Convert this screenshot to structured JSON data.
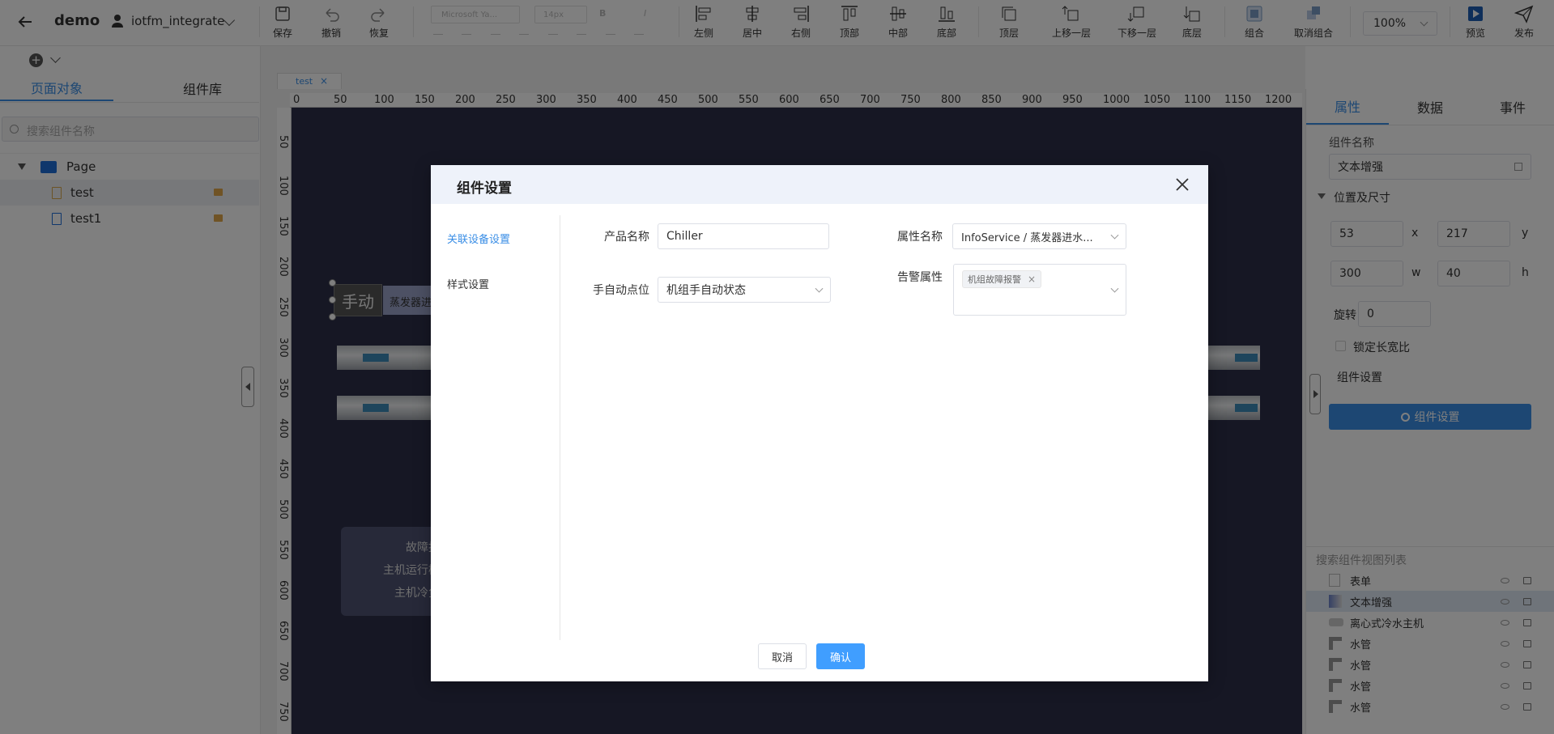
{
  "header": {
    "project": "demo",
    "user": "iotfm_integrate",
    "font_family": "Microsoft Ya...",
    "font_size": "14px",
    "zoom": "100%",
    "tools": {
      "save": "保存",
      "undo": "撤销",
      "redo": "恢复",
      "left": "左侧",
      "center": "居中",
      "right": "右侧",
      "top": "顶部",
      "middle": "中部",
      "bottom": "底部",
      "front": "顶层",
      "forward": "上移一层",
      "backward": "下移一层",
      "back": "底层",
      "group": "组合",
      "ungroup": "取消组合",
      "preview": "预览",
      "publish": "发布"
    }
  },
  "left_panel": {
    "tabs": [
      "页面对象",
      "组件库"
    ],
    "search_placeholder": "搜索组件名称",
    "tree": {
      "root": "Page",
      "children": [
        "test",
        "test1"
      ]
    }
  },
  "canvas": {
    "tab": "test",
    "ruler_x": [
      "0",
      "50",
      "100",
      "150",
      "200",
      "250",
      "300",
      "350",
      "400",
      "450",
      "500",
      "550",
      "600",
      "650",
      "700",
      "750",
      "800",
      "850",
      "900",
      "950",
      "1000",
      "1050",
      "1100",
      "1150",
      "1200"
    ],
    "ruler_y": [
      "50",
      "100",
      "150",
      "200",
      "250",
      "300",
      "350",
      "400",
      "450",
      "500",
      "550",
      "600",
      "650",
      "700",
      "750"
    ],
    "widget_manual": "手动",
    "widget_text": "蒸发器进",
    "info_lines": [
      "故障报",
      "主机运行模",
      "主机冷负"
    ]
  },
  "right_panel": {
    "tabs": [
      "属性",
      "数据",
      "事件"
    ],
    "name_label": "组件名称",
    "name_value": "文本增强",
    "pos_section": "位置及尺寸",
    "x": "53",
    "x_label": "x",
    "y": "217",
    "y_label": "y",
    "w": "300",
    "w_label": "w",
    "h": "40",
    "h_label": "h",
    "rotate_label": "旋转",
    "rotate": "0",
    "lock_ratio": "锁定长宽比",
    "settings_label": "组件设置",
    "settings_button": "组件设置",
    "layer_search": "搜索组件视图列表",
    "layers": [
      "表单",
      "文本增强",
      "离心式冷水主机",
      "水管",
      "水管",
      "水管",
      "水管"
    ]
  },
  "modal": {
    "title": "组件设置",
    "nav": [
      "关联设备设置",
      "样式设置"
    ],
    "product_label": "产品名称",
    "product_value": "Chiller",
    "attr_label": "属性名称",
    "attr_value": "InfoService / 蒸发器进水...",
    "manual_label": "手自动点位",
    "manual_value": "机组手自动状态",
    "alarm_label": "告警属性",
    "alarm_tag": "机组故障报警",
    "cancel": "取消",
    "confirm": "确认"
  },
  "colors": {
    "accent": "#3a8ee6",
    "canvas_bg": "#2d2f48",
    "modal_header": "#eef2fa"
  }
}
